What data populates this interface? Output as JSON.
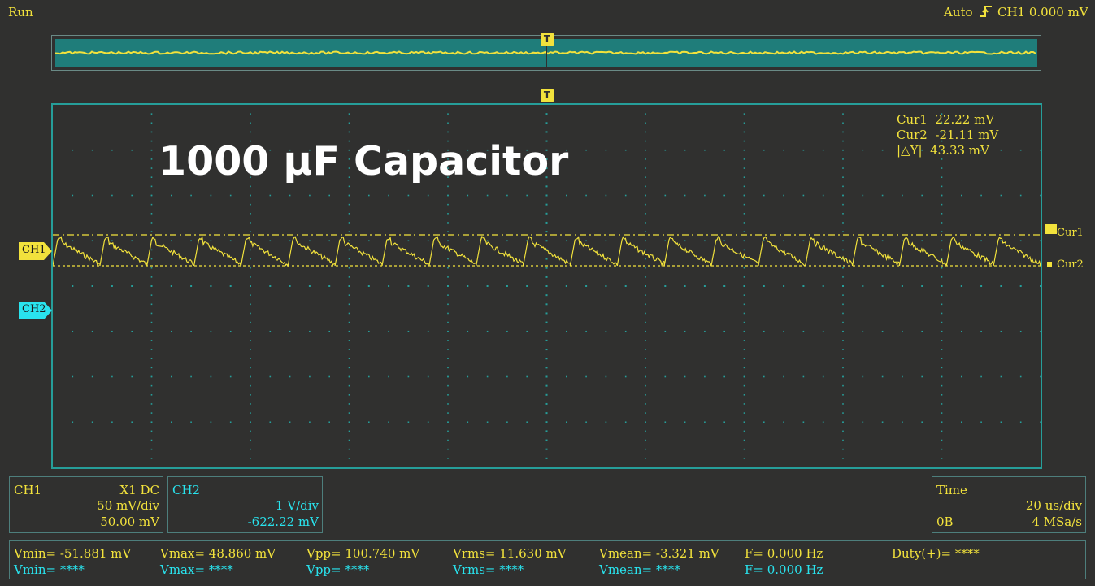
{
  "status": {
    "run_state": "Run"
  },
  "trigger": {
    "mode": "Auto",
    "source_level": "CH1 0.000 mV",
    "marker": "T"
  },
  "overlay_title": "1000 μF Capacitor",
  "cursors": {
    "cur1": {
      "label": "Cur1",
      "value": "22.22 mV"
    },
    "cur2": {
      "label": "Cur2",
      "value": "-21.11 mV"
    },
    "delta": {
      "label": "|△Y|",
      "value": "43.33 mV"
    }
  },
  "channel_tags": {
    "ch1": "CH1",
    "ch2": "CH2"
  },
  "ch1_panel": {
    "title": "CH1",
    "coupling": "X1  DC",
    "scale": "50 mV/div",
    "offset": "50.00 mV"
  },
  "ch2_panel": {
    "title": "CH2",
    "scale": "1 V/div",
    "offset": "-622.22 mV"
  },
  "time_panel": {
    "title": "Time",
    "timebase": "20 us/div",
    "memory": "0B",
    "sample_rate": "4 MSa/s"
  },
  "measurements": {
    "ch1": {
      "vmin": "Vmin= -51.881 mV",
      "vmax": "Vmax= 48.860 mV",
      "vpp": "Vpp= 100.740 mV",
      "vrms": "Vrms= 11.630 mV",
      "vmean": "Vmean= -3.321 mV",
      "freq": "F= 0.000 Hz",
      "duty": "Duty(+)= ****"
    },
    "ch2": {
      "vmin": "Vmin= ****",
      "vmax": "Vmax= ****",
      "vpp": "Vpp= ****",
      "vrms": "Vrms= ****",
      "vmean": "Vmean= ****",
      "freq": "F= 0.000 Hz"
    }
  },
  "colors": {
    "ch1": "#f2e23c",
    "ch2": "#29e3ee",
    "grid": "#269e9a",
    "background": "#30302f"
  },
  "waveform": {
    "periods": 21,
    "vmin_mv": -51.881,
    "vmax_mv": 48.86,
    "scale_mv_per_div": 50
  }
}
